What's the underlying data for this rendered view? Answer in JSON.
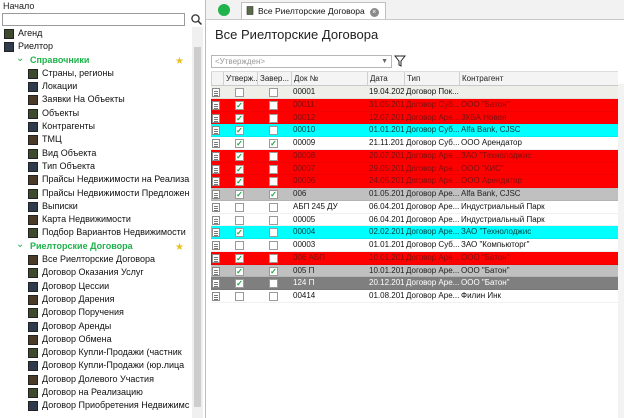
{
  "sidebar": {
    "title": "Начало",
    "search_placeholder": "",
    "items": [
      {
        "label": "Агенд",
        "level": 1,
        "type": "item"
      },
      {
        "label": "Риелтор",
        "level": 1,
        "type": "item"
      },
      {
        "label": "Справочники",
        "level": 2,
        "type": "group",
        "star": true
      },
      {
        "label": "Страны, регионы",
        "level": 3,
        "type": "item"
      },
      {
        "label": "Локации",
        "level": 3,
        "type": "item"
      },
      {
        "label": "Заявки На Объекты",
        "level": 3,
        "type": "item"
      },
      {
        "label": "Объекты",
        "level": 3,
        "type": "item"
      },
      {
        "label": "Контрагенты",
        "level": 3,
        "type": "item"
      },
      {
        "label": "ТМЦ",
        "level": 3,
        "type": "item"
      },
      {
        "label": "Вид Объекта",
        "level": 3,
        "type": "item"
      },
      {
        "label": "Тип Объекта",
        "level": 3,
        "type": "item"
      },
      {
        "label": "Прайсы Недвижимости на Реализа",
        "level": 3,
        "type": "item"
      },
      {
        "label": "Прайсы Недвижимости Предложен",
        "level": 3,
        "type": "item"
      },
      {
        "label": "Выписки",
        "level": 3,
        "type": "item"
      },
      {
        "label": "Карта Недвижимости",
        "level": 3,
        "type": "item"
      },
      {
        "label": "Подбор Вариантов Недвижимости",
        "level": 3,
        "type": "item"
      },
      {
        "label": "Риелторские Договора",
        "level": 2,
        "type": "group",
        "star": true
      },
      {
        "label": "Все Риелторские Договора",
        "level": 3,
        "type": "item"
      },
      {
        "label": "Договор Оказания Услуг",
        "level": 3,
        "type": "item"
      },
      {
        "label": "Договор Цессии",
        "level": 3,
        "type": "item"
      },
      {
        "label": "Договор Дарения",
        "level": 3,
        "type": "item"
      },
      {
        "label": "Договор Поручения",
        "level": 3,
        "type": "item"
      },
      {
        "label": "Договор Аренды",
        "level": 3,
        "type": "item"
      },
      {
        "label": "Договор Обмена",
        "level": 3,
        "type": "item"
      },
      {
        "label": "Договор Купли-Продажи (частник",
        "level": 3,
        "type": "item"
      },
      {
        "label": "Договор Купли-Продажи (юр.лица",
        "level": 3,
        "type": "item"
      },
      {
        "label": "Договор Долевого Участия",
        "level": 3,
        "type": "item"
      },
      {
        "label": "Договор на Реализацию",
        "level": 3,
        "type": "item"
      },
      {
        "label": "Договор Приобретения Недвижимс",
        "level": 3,
        "type": "item"
      }
    ]
  },
  "tabbar": {
    "tab_label": "Все Риелторские Договора",
    "close_icon": "close-icon"
  },
  "main": {
    "page_title": "Все Риелторские Договора",
    "filter_value": "<Утвержден>"
  },
  "grid": {
    "columns": [
      "",
      "Утверж...",
      "Завер...",
      "Док №",
      "Дата",
      "Тип",
      "Контрагент"
    ],
    "rows": [
      {
        "color": "light",
        "approved": false,
        "done": false,
        "doc": "00001",
        "date": "19.04.2022",
        "type": "Договор Пок...",
        "party": ""
      },
      {
        "color": "red",
        "approved": true,
        "done": false,
        "doc": "00011",
        "date": "31.05.2013",
        "type": "Договор Суб...",
        "party": "ООО \"Батон\""
      },
      {
        "color": "red",
        "approved": true,
        "done": false,
        "doc": "00012",
        "date": "12.07.2013",
        "type": "Договор Аре...",
        "party": "ЗКБА Новоя"
      },
      {
        "color": "cyan",
        "approved": true,
        "done": false,
        "doc": "00010",
        "date": "01.01.2013",
        "type": "Договор Суб...",
        "party": "Alfa Bank, CJSC"
      },
      {
        "color": "white",
        "approved": true,
        "done": true,
        "doc": "00009",
        "date": "21.11.2012",
        "type": "Договор Суб...",
        "party": "ООО Арендатор"
      },
      {
        "color": "red",
        "approved": true,
        "done": false,
        "doc": "00008",
        "date": "20.07.2012",
        "type": "Договор Аре...",
        "party": "ЗАО \"Технолоджис"
      },
      {
        "color": "red",
        "approved": true,
        "done": false,
        "doc": "00007",
        "date": "29.05.2012",
        "type": "Договор Аре...",
        "party": "ООО \"КИС\""
      },
      {
        "color": "red",
        "approved": true,
        "done": false,
        "doc": "00006",
        "date": "24.05.2012",
        "type": "Договор Аре...",
        "party": "ООО Арендатор"
      },
      {
        "color": "gray",
        "approved": true,
        "done": true,
        "doc": "006",
        "date": "01.05.2012",
        "type": "Договор Аре...",
        "party": "Alfa Bank, CJSC"
      },
      {
        "color": "white",
        "approved": false,
        "done": false,
        "doc": "АБП 245 ДУ",
        "date": "06.04.2012",
        "type": "Договор Аре...",
        "party": "Индустриальный Парк"
      },
      {
        "color": "white",
        "approved": false,
        "done": false,
        "doc": "00005",
        "date": "06.04.2012",
        "type": "Договор Аре...",
        "party": "Индустриальный Парк"
      },
      {
        "color": "cyan",
        "approved": true,
        "done": false,
        "doc": "00004",
        "date": "02.02.2012",
        "type": "Договор Аре...",
        "party": "ЗАО \"Технолоджис"
      },
      {
        "color": "white",
        "approved": false,
        "done": false,
        "doc": "00003",
        "date": "01.01.2012",
        "type": "Договор Суб...",
        "party": "ЗАО \"Компьюторг\""
      },
      {
        "color": "red",
        "approved": true,
        "done": false,
        "doc": "006 АБП",
        "date": "10.01.2012",
        "type": "Договор Аре...",
        "party": "ООО \"Батон\""
      },
      {
        "color": "gray",
        "approved": true,
        "done": true,
        "doc": "005 П",
        "date": "10.01.2012",
        "type": "Договор Аре...",
        "party": "ООО \"Батон\""
      },
      {
        "color": "dark",
        "approved": true,
        "done": false,
        "doc": "124 П",
        "date": "20.12.2011",
        "type": "Договор Аре...",
        "party": "ООО \"Батон\""
      },
      {
        "color": "white",
        "approved": false,
        "done": false,
        "doc": "00414",
        "date": "01.08.2011",
        "type": "Договор Аре...",
        "party": "Филин Инк"
      }
    ]
  },
  "colors": {
    "group": "#1db34a",
    "red": "#ff0000",
    "cyan": "#00ffff",
    "gray": "#c0c0c0",
    "dark": "#7f7f7f"
  }
}
